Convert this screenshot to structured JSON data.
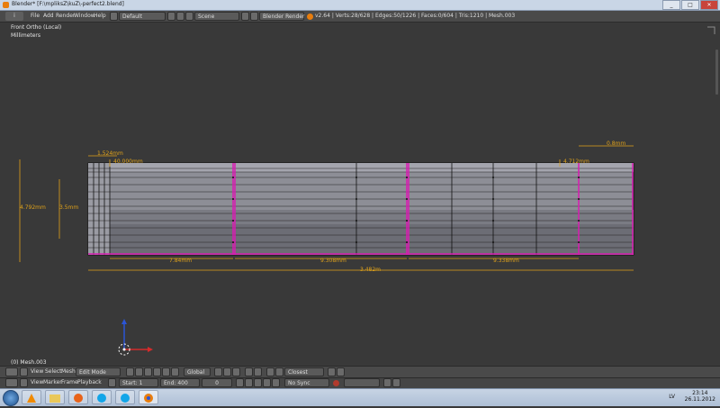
{
  "window": {
    "title": "Blender* [F:\\mpliksZ\\kuZ\\-perfect2.blend]",
    "controls": [
      "_",
      "□",
      "✕"
    ]
  },
  "info_header": {
    "editor_icon": "i",
    "menus": [
      "File",
      "Add",
      "Render",
      "Window",
      "Help"
    ],
    "layout": "Default",
    "scene": "Scene",
    "engine": "Blender Render",
    "stats": "v2.64 | Verts:28/628 | Edges:50/1226 | Faces:0/604 | Tris:1210 | Mesh.003"
  },
  "viewport": {
    "view_name": "Front Ortho (Local)",
    "units": "Millimeters",
    "object_info": "(0) Mesh.003",
    "dimensions": {
      "left_outer": "4.792mm",
      "left_inner": "3.5mm",
      "top_left": "1.524mm",
      "top_left_inner": "40.000mm",
      "top_right": "0.8mm",
      "top_right_inner": "4.712mm",
      "bottom_seg1": "7.84mm",
      "bottom_seg2": "9.308mm",
      "bottom_seg3": "9.338mm",
      "total": "3.482m"
    }
  },
  "view3d_header": {
    "menus": [
      "View",
      "Select",
      "Mesh"
    ],
    "mode": "Edit Mode",
    "orientation": "Global",
    "snap": "Closest"
  },
  "timeline_header": {
    "menus": [
      "View",
      "Marker",
      "Frame",
      "Playback"
    ],
    "start_label": "Start: 1",
    "end_label": "End: 400",
    "current_frame": "0",
    "sync": "No Sync"
  },
  "taskbar": {
    "apps": [
      "vlc-icon",
      "folder-icon",
      "firefox-icon",
      "skype-icon",
      "skype-icon",
      "blender-icon"
    ],
    "language": "LV",
    "time": "23:14",
    "date": "26.11.2012"
  },
  "colors": {
    "mesh_face": "#8d8e96",
    "mesh_edge": "#111111",
    "seam": "#d81cb2",
    "dimension": "#e0a21a",
    "accent": "#e87d0d"
  }
}
